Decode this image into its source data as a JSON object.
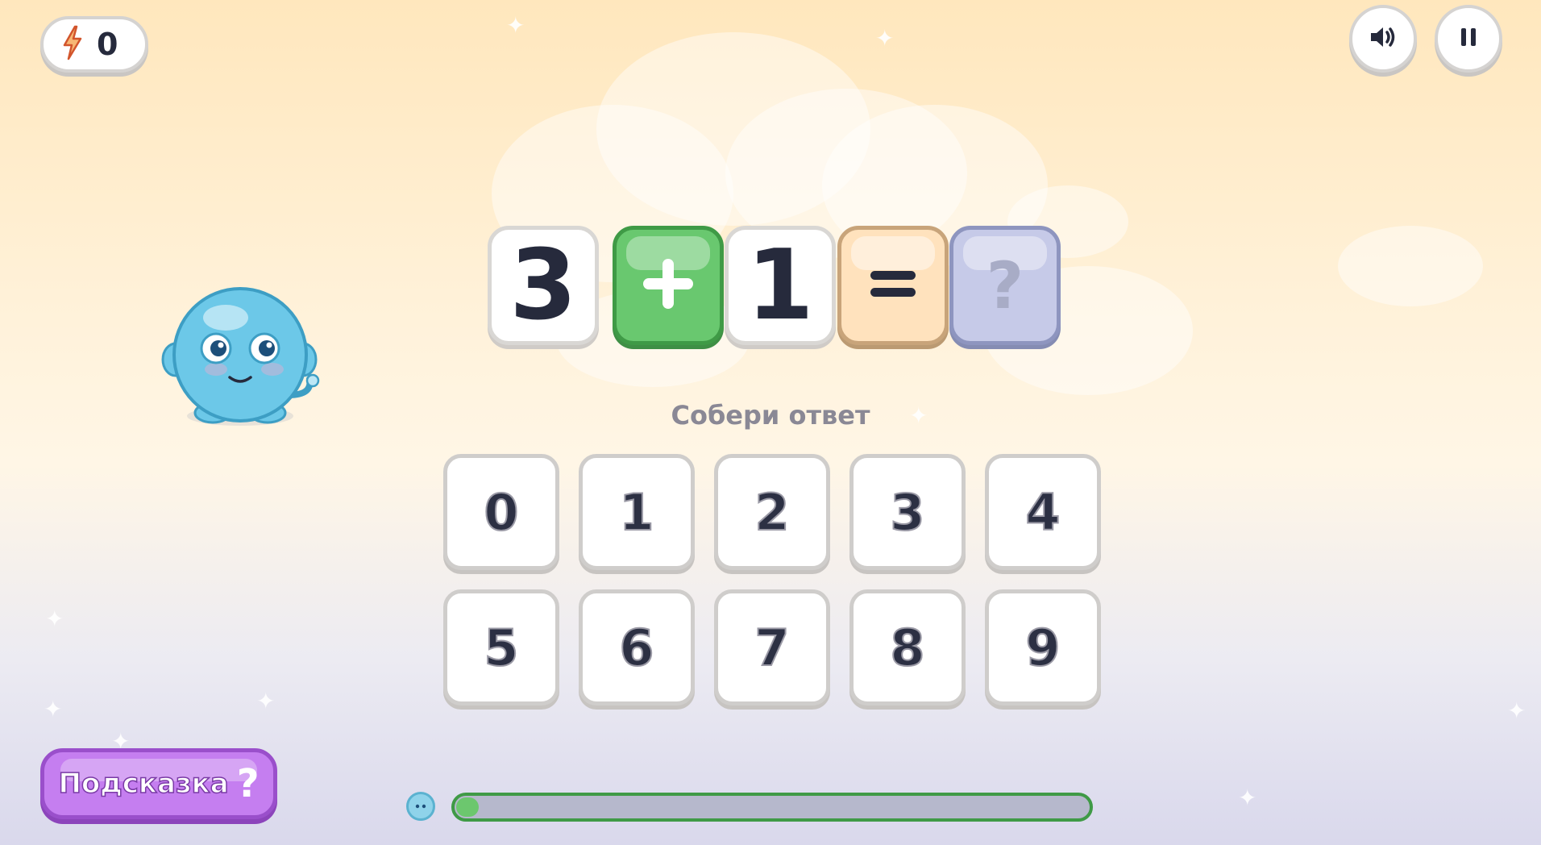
{
  "score": {
    "icon": "lightning-icon",
    "value": "0"
  },
  "controls": {
    "sound_icon": "speaker-icon",
    "pause_icon": "pause-icon"
  },
  "equation": {
    "operand1": "3",
    "operator": "+",
    "operand2": "1",
    "equals": "=",
    "answer": "?"
  },
  "prompt": "Собери ответ",
  "keypad": [
    "0",
    "1",
    "2",
    "3",
    "4",
    "5",
    "6",
    "7",
    "8",
    "9"
  ],
  "hint": {
    "label": "Подсказка",
    "icon": "?"
  },
  "progress": {
    "fraction": 0.02
  },
  "colors": {
    "accent_green": "#69c86f",
    "hint_purple": "#c57ef0",
    "equals_peach": "#ffe2bd",
    "answer_lavender": "#c6cae8",
    "creature_blue": "#6cc8e8"
  }
}
